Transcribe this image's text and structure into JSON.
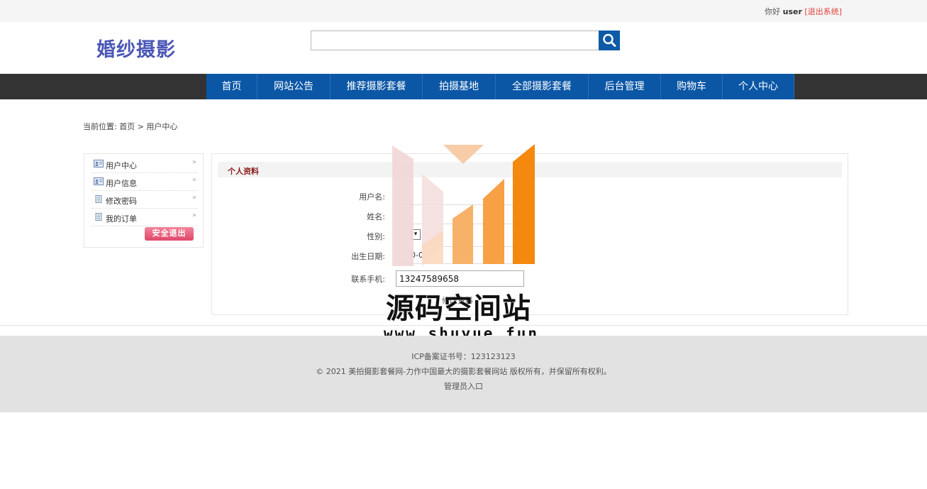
{
  "topbar": {
    "greeting": "你好 ",
    "username": "user",
    "logout": "[退出系统]"
  },
  "header": {
    "logo": "婚纱摄影",
    "search_placeholder": ""
  },
  "nav": {
    "items": [
      "首页",
      "网站公告",
      "推荐摄影套餐",
      "拍摄基地",
      "全部摄影套餐",
      "后台管理",
      "购物车",
      "个人中心"
    ]
  },
  "breadcrumb": {
    "text": "当前位置: 首页 > 用户中心"
  },
  "sidebar": {
    "items": [
      {
        "label": "用户中心",
        "icon": "user-card-icon"
      },
      {
        "label": "用户信息",
        "icon": "user-card-icon"
      },
      {
        "label": "修改密码",
        "icon": "document-icon"
      },
      {
        "label": "我的订单",
        "icon": "document-icon"
      }
    ],
    "exit_label": "安全退出"
  },
  "profile": {
    "title": "个人资料",
    "fields": {
      "username_label": "用户名:",
      "name_label": "姓名:",
      "gender_label": "性别:",
      "birth_label": "出生日期:",
      "phone_label": "联系手机:",
      "phone_value": "13247589658",
      "birth_partial": "0-0"
    },
    "submit_label": "修改资料"
  },
  "watermark": {
    "title": "源码空间站",
    "url": "www.shuyue.fun"
  },
  "footer": {
    "icp": "ICP备案证书号：123123123",
    "copyright": "© 2021 美拍摄影套餐网-力作中国最大的摄影套餐网站 版权所有，并保留所有权利。",
    "admin": "管理员入口"
  },
  "colors": {
    "nav_blue": "#0b57a6",
    "logo": "#4a56b6",
    "logout": "#e0423a",
    "watermark_orange": "#f5880f"
  }
}
